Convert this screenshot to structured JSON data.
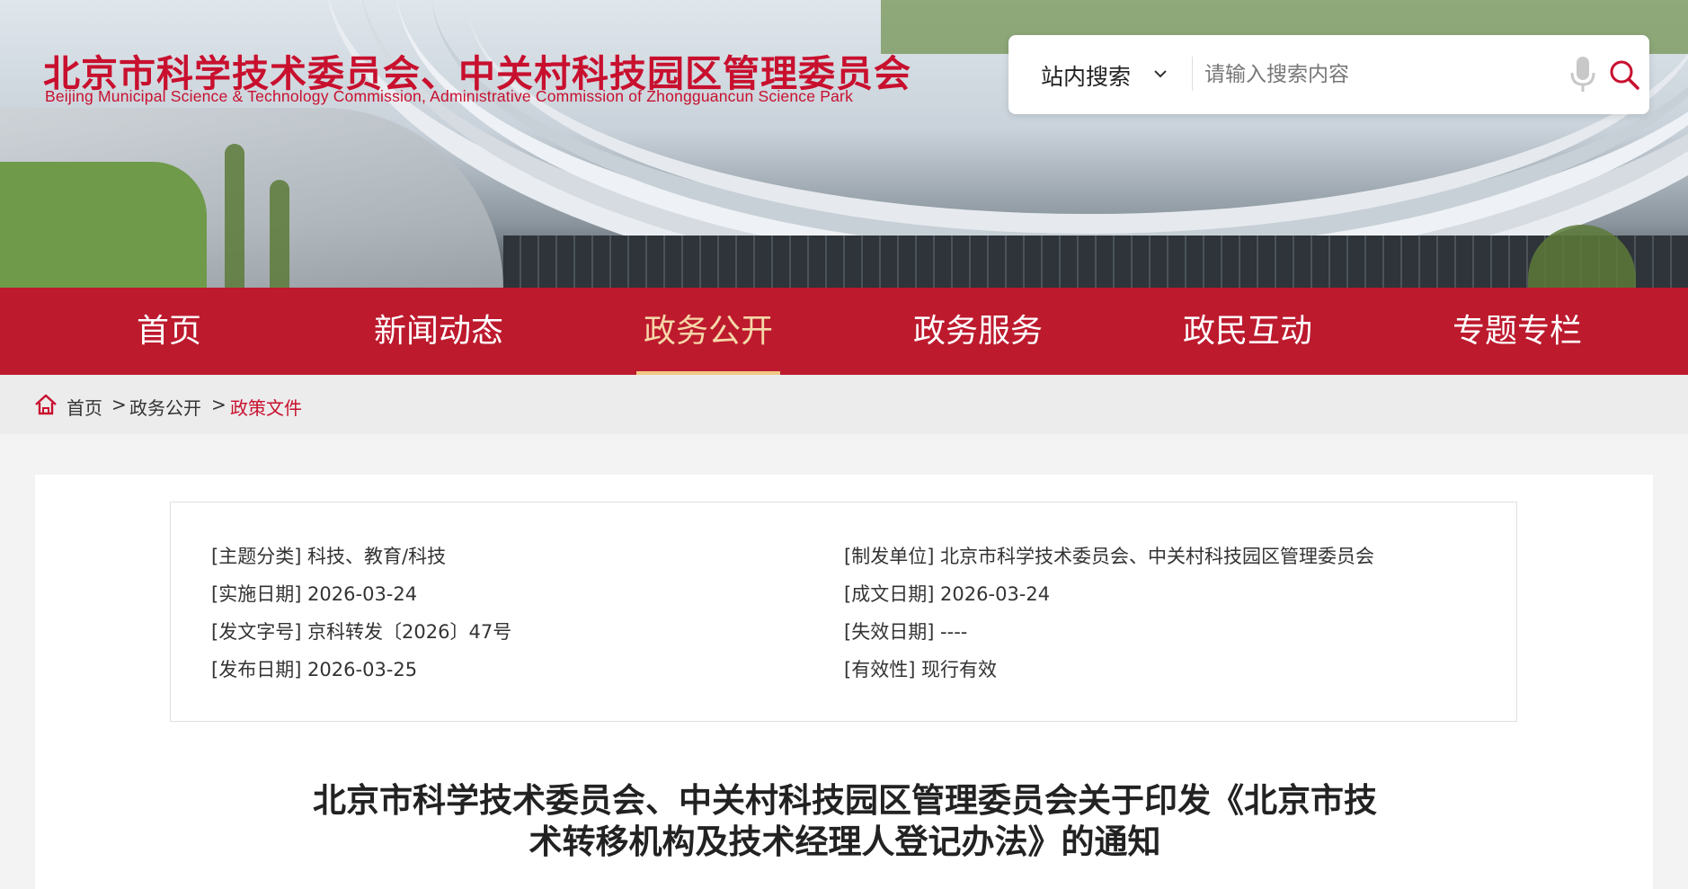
{
  "header": {
    "title": "北京市科学技术委员会、中关村科技园区管理委员会",
    "subtitle": "Beijing Municipal Science & Technology Commission, Administrative Commission of Zhongguancun Science Park"
  },
  "search": {
    "scope": "站内搜索",
    "placeholder": "请输入搜索内容"
  },
  "nav": {
    "items": [
      {
        "label": "首页"
      },
      {
        "label": "新闻动态"
      },
      {
        "label": "政务公开",
        "active": true
      },
      {
        "label": "政务服务"
      },
      {
        "label": "政民互动"
      },
      {
        "label": "专题专栏"
      }
    ]
  },
  "breadcrumb": {
    "items": [
      "首页",
      "政务公开",
      "政策文件"
    ],
    "separator": ">"
  },
  "meta": {
    "topic": "[主题分类] 科技、教育/科技",
    "implement_date": "[实施日期] 2026-03-24",
    "doc_number": "[发文字号] 京科转发〔2026〕47号",
    "publish_date": "[发布日期] 2026-03-25",
    "issuer": "[制发单位] 北京市科学技术委员会、中关村科技园区管理委员会",
    "written_date": "[成文日期] 2026-03-24",
    "expiry_date": "[失效日期] ----",
    "validity": "[有效性] 现行有效"
  },
  "document": {
    "title_line1": "北京市科学技术委员会、中关村科技园区管理委员会关于印发《北京市技",
    "title_line2": "术转移机构及技术经理人登记办法》的通知"
  },
  "colors": {
    "brand_red": "#bd1a2e",
    "title_red": "#c8102e",
    "active_nav": "#f5d7a8"
  }
}
